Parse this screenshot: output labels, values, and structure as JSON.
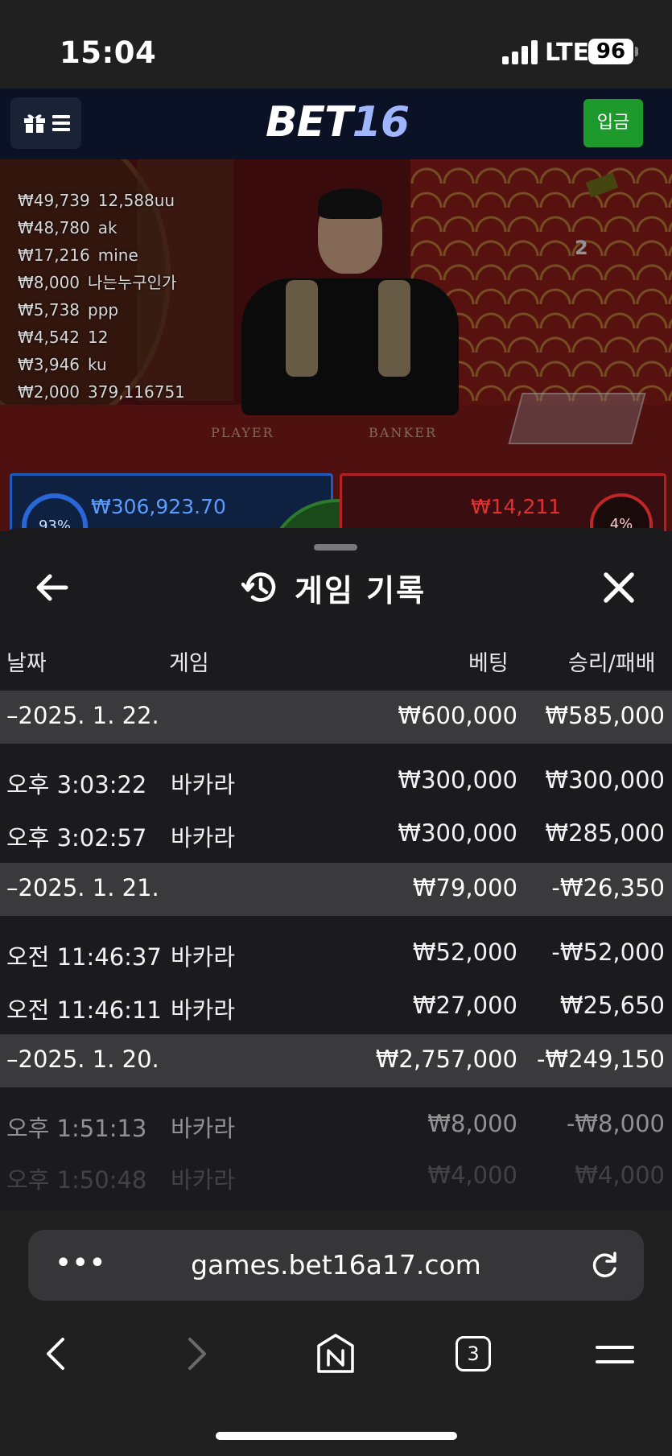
{
  "status_bar": {
    "time": "15:04",
    "network": "LTE",
    "battery": "96"
  },
  "header": {
    "logo_main": "BET",
    "logo_num": "16",
    "deposit_label": "입금"
  },
  "game_view": {
    "winners": [
      {
        "amount": "₩49,739",
        "name": "12,588uu"
      },
      {
        "amount": "₩48,780",
        "name": "ak"
      },
      {
        "amount": "₩17,216",
        "name": "mine"
      },
      {
        "amount": "₩8,000",
        "name": "나는누구인가"
      },
      {
        "amount": "₩5,738",
        "name": "ppp"
      },
      {
        "amount": "₩4,542",
        "name": "12"
      },
      {
        "amount": "₩3,946",
        "name": "ku"
      },
      {
        "amount": "₩2,000",
        "name": "379,116751"
      }
    ],
    "round_number": "2",
    "player_label": "PLAYER",
    "banker_label": "BANKER",
    "player_percent": "93%",
    "player_amount": "₩306,923.70",
    "banker_amount": "₩14,211",
    "banker_percent": "4%"
  },
  "sheet": {
    "title": "게임 기록",
    "columns": {
      "date": "날짜",
      "game": "게임",
      "bet": "베팅",
      "result": "승리/패배"
    },
    "groups": [
      {
        "date": "–2025. 1. 22.",
        "bet": "₩600,000",
        "result": "₩585,000",
        "rows": [
          {
            "time": "오후 3:03:22",
            "game": "바카라",
            "bet": "₩300,000",
            "result": "₩300,000"
          },
          {
            "time": "오후 3:02:57",
            "game": "바카라",
            "bet": "₩300,000",
            "result": "₩285,000"
          }
        ]
      },
      {
        "date": "–2025. 1. 21.",
        "bet": "₩79,000",
        "result": "-₩26,350",
        "rows": [
          {
            "time": "오전 11:46:37",
            "game": "바카라",
            "bet": "₩52,000",
            "result": "-₩52,000"
          },
          {
            "time": "오전 11:46:11",
            "game": "바카라",
            "bet": "₩27,000",
            "result": "₩25,650"
          }
        ]
      },
      {
        "date": "–2025. 1. 20.",
        "bet": "₩2,757,000",
        "result": "-₩249,150",
        "rows": [
          {
            "time": "오후 1:51:13",
            "game": "바카라",
            "bet": "₩8,000",
            "result": "-₩8,000"
          },
          {
            "time": "오후 1:50:48",
            "game": "바카라",
            "bet": "₩4,000",
            "result": "₩4,000"
          }
        ]
      }
    ]
  },
  "browser": {
    "url": "games.bet16a17.com",
    "menu_dots": "•••",
    "tab_count": "3"
  },
  "colors": {
    "deposit_green": "#1e9a2c",
    "player_blue": "#1d5bbd",
    "banker_red": "#b52020",
    "group_row": "#3a3a3c"
  }
}
